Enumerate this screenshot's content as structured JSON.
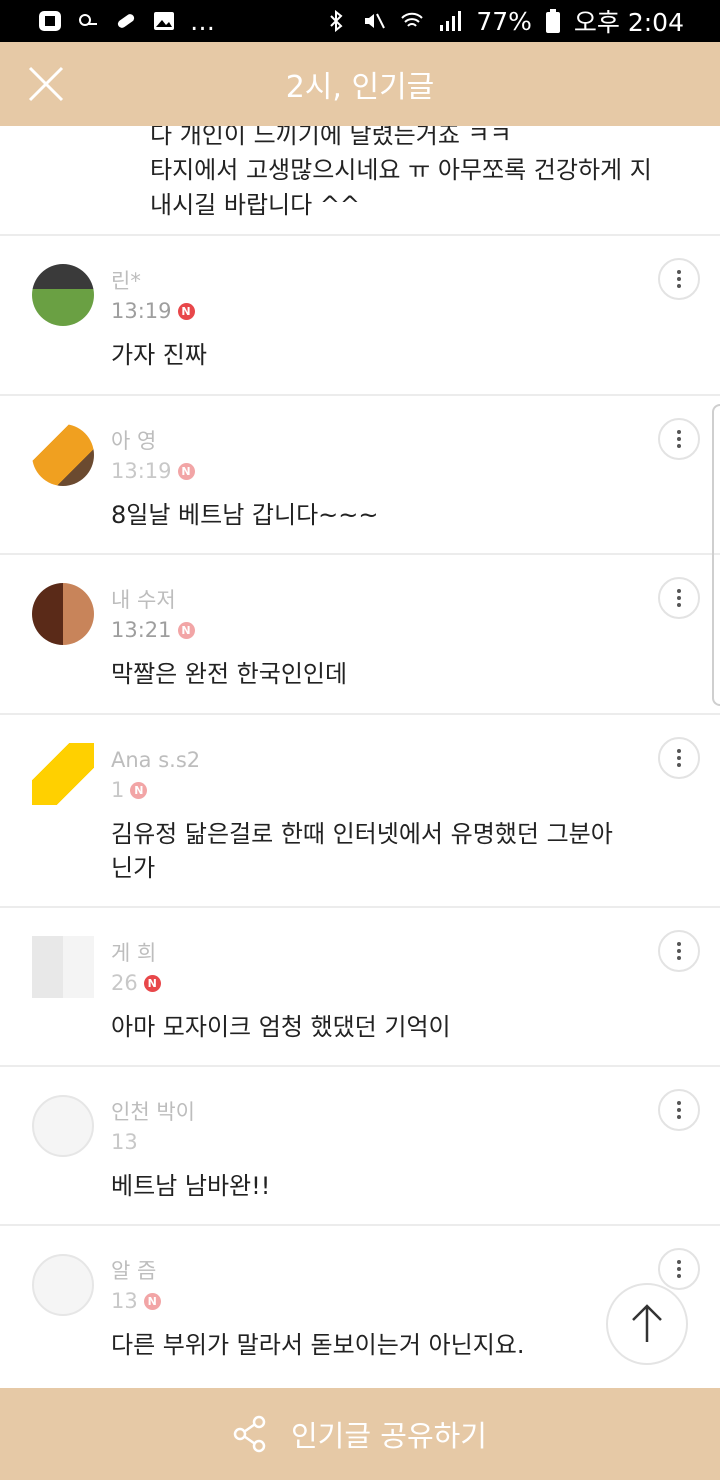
{
  "status_bar": {
    "battery": "77%",
    "time": "오후 2:04"
  },
  "header": {
    "title": "2시, 인기글",
    "close_icon": "close-icon"
  },
  "top_partial": {
    "lines": [
      "다 개인이 느끼기에 달렸는거죠 ㅋㅋ",
      "타지에서 고생많으시네요 ㅠ 아무쪼록 건강하게 지",
      "내시길 바랍니다 ^^"
    ]
  },
  "comments": [
    {
      "name": "린*",
      "time": "13:19",
      "badge": "N",
      "text": "가자 진짜"
    },
    {
      "name": "아 영",
      "time": "13:19",
      "badge": "N",
      "text": "8일날 베트남 갑니다~~~"
    },
    {
      "name": "내 수저",
      "time": "13:21",
      "badge": "N",
      "text": "막짤은 완전 한국인인데"
    },
    {
      "name": "Ana s.s2",
      "time": "1",
      "badge": "N",
      "text": "김유정 닮은걸로 한때 인터넷에서 유명했던 그분아닌가"
    },
    {
      "name": "게 희",
      "time": "26",
      "badge": "N",
      "text": "아마 모자이크 엄청 했댔던 기억이"
    },
    {
      "name": "인천 박이",
      "time": "13",
      "badge": "",
      "text": "베트남 남바완!!"
    },
    {
      "name": "알 즘",
      "time": "13",
      "badge": "N",
      "text": "다른 부위가 말라서 돋보이는거 아닌지요."
    }
  ],
  "bottom_bar": {
    "share_label": "인기글 공유하기",
    "share_icon": "share-icon"
  },
  "colors": {
    "header_bg": "#e6c9a6",
    "badge": "#e8474a"
  }
}
